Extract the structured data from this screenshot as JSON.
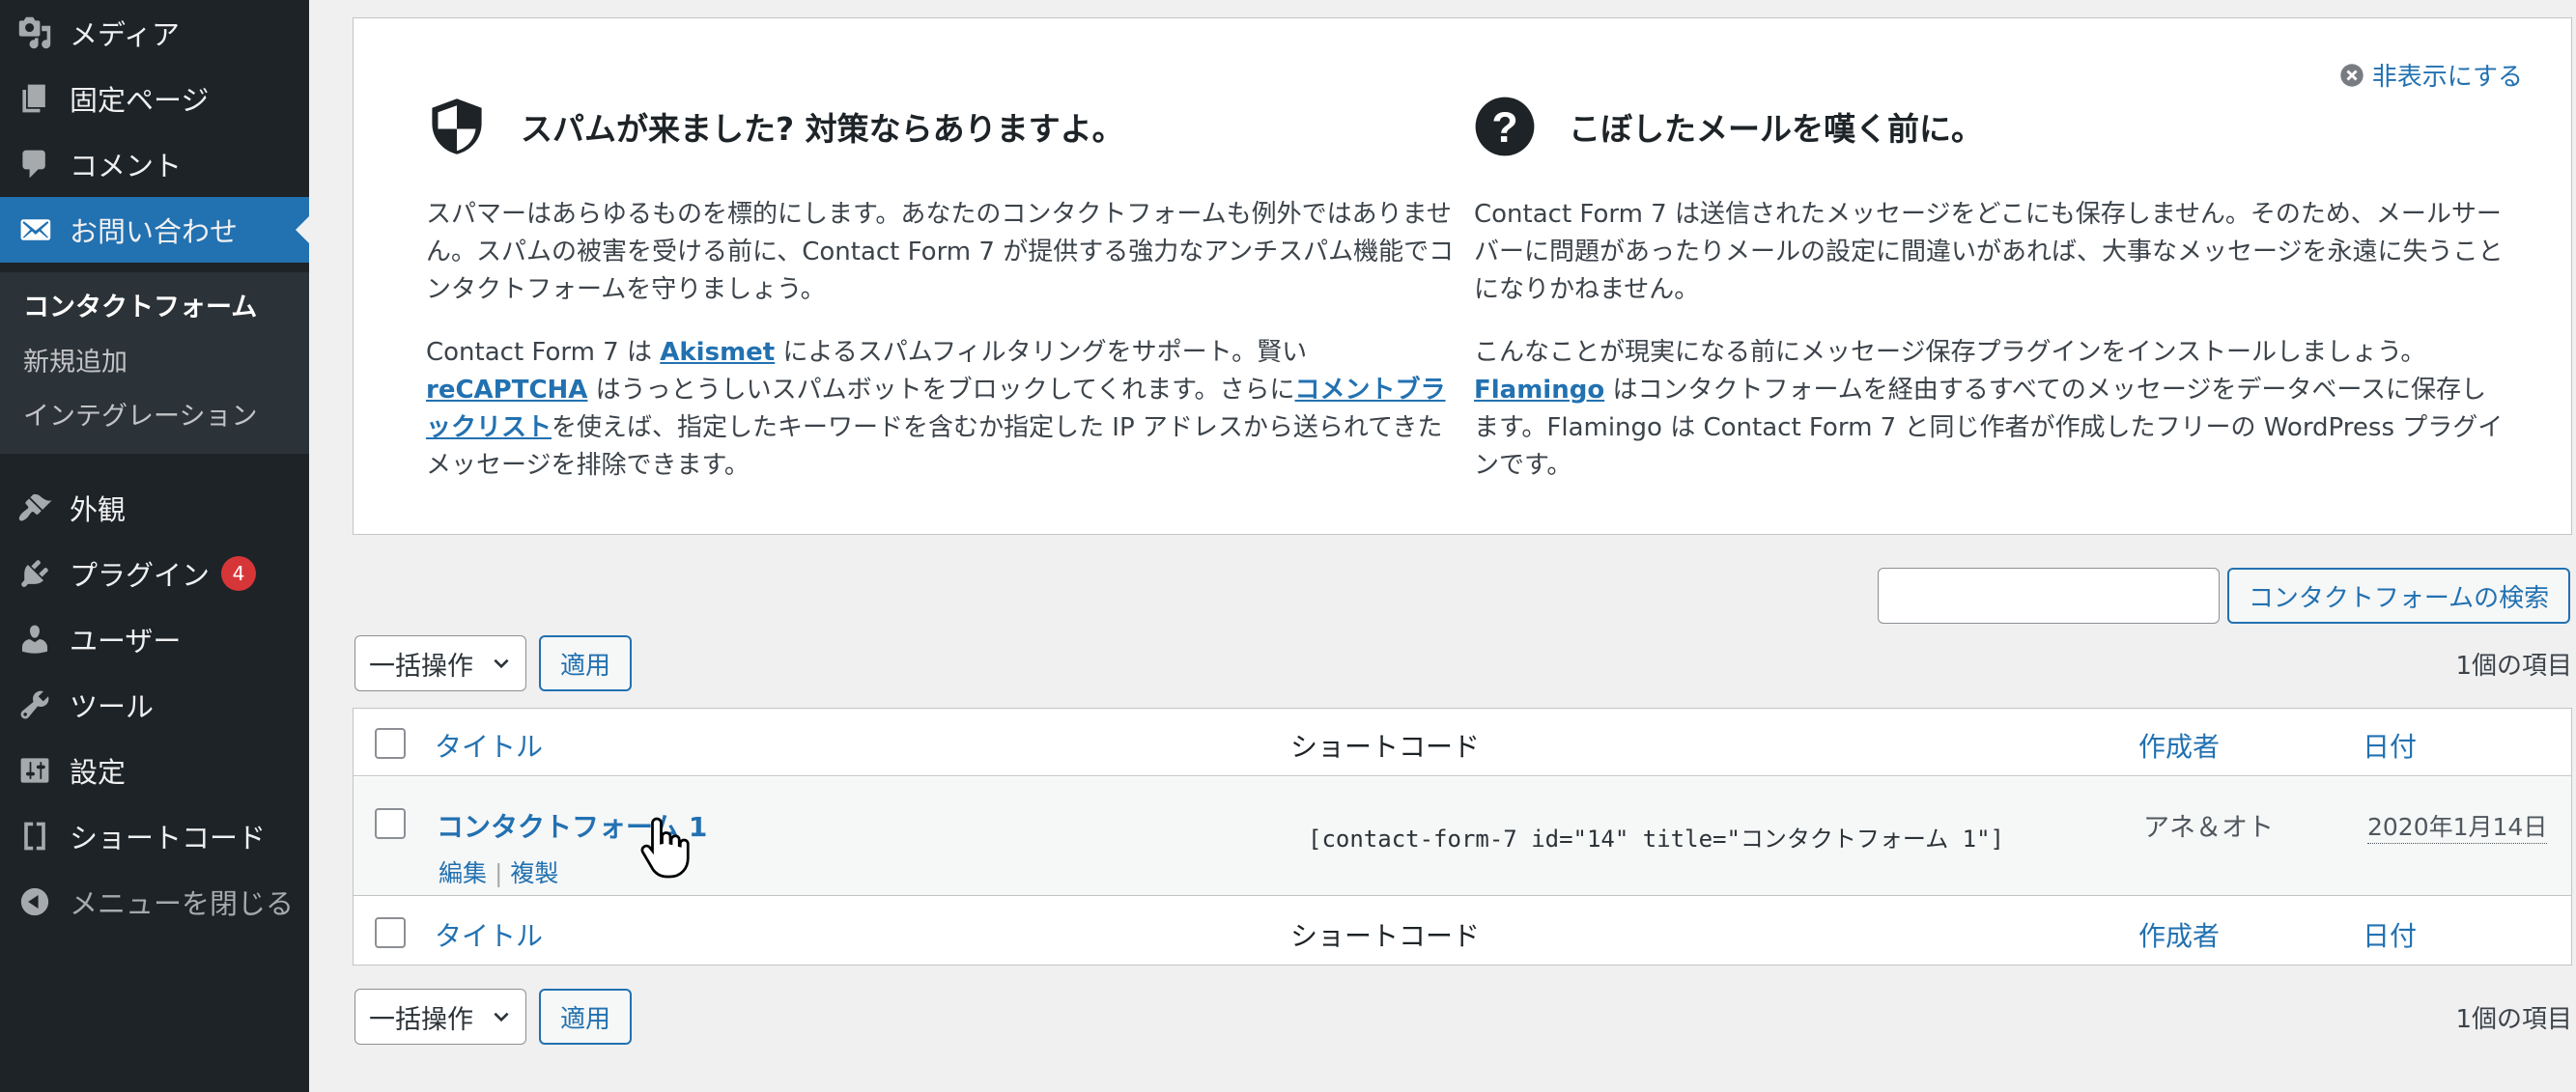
{
  "sidebar": {
    "items": [
      {
        "label": "メディア",
        "icon": "media-icon"
      },
      {
        "label": "固定ページ",
        "icon": "pages-icon"
      },
      {
        "label": "コメント",
        "icon": "comments-icon"
      },
      {
        "label": "お問い合わせ",
        "icon": "mail-icon"
      },
      {
        "label": "外観",
        "icon": "appearance-icon"
      },
      {
        "label": "プラグイン",
        "icon": "plugins-icon",
        "badge": "4"
      },
      {
        "label": "ユーザー",
        "icon": "users-icon"
      },
      {
        "label": "ツール",
        "icon": "tools-icon"
      },
      {
        "label": "設定",
        "icon": "settings-icon"
      },
      {
        "label": "ショートコード",
        "icon": "shortcode-icon"
      },
      {
        "label": "メニューを閉じる",
        "icon": "collapse-icon"
      }
    ],
    "submenu": [
      {
        "label": "コンタクトフォーム"
      },
      {
        "label": "新規追加"
      },
      {
        "label": "インテグレーション"
      }
    ]
  },
  "welcome": {
    "dismiss_label": "非表示にする",
    "left": {
      "title": "スパムが来ました? 対策ならありますよ。",
      "para1": "スパマーはあらゆるものを標的にします。あなたのコンタクトフォームも例外ではありません。スパムの被害を受ける前に、Contact Form 7 が提供する強力なアンチスパム機能でコンタクトフォームを守りましょう。",
      "para2_parts": [
        "Contact Form 7 は ",
        "Akismet",
        " によるスパムフィルタリングをサポート。賢い ",
        "reCAPTCHA",
        " はうっとうしいスパムボットをブロックしてくれます。さらに",
        "コメントブラックリスト",
        "を使えば、指定したキーワードを含むか指定した IP アドレスから送られてきたメッセージを排除できます。"
      ]
    },
    "right": {
      "title": "こぼしたメールを嘆く前に。",
      "para1": "Contact Form 7 は送信されたメッセージをどこにも保存しません。そのため、メールサーバーに問題があったりメールの設定に間違いがあれば、大事なメッセージを永遠に失うことになりかねません。",
      "para2_parts": [
        "こんなことが現実になる前にメッセージ保存プラグインをインストールしましょう。",
        "Flamingo",
        " はコンタクトフォームを経由するすべてのメッセージをデータベースに保存します。Flamingo は Contact Form 7 と同じ作者が作成したフリーの WordPress プラグインです。"
      ]
    }
  },
  "search": {
    "button_label": "コンタクトフォームの検索",
    "value": ""
  },
  "bulk": {
    "label": "一括操作",
    "apply_label": "適用",
    "count": "1個の項目"
  },
  "table": {
    "columns": {
      "title": "タイトル",
      "shortcode": "ショートコード",
      "author": "作成者",
      "date": "日付"
    },
    "rows": [
      {
        "title": "コンタクトフォーム 1",
        "actions": [
          "編集",
          "複製"
        ],
        "shortcode": "[contact-form-7 id=\"14\" title=\"コンタクトフォーム 1\"]",
        "author": "アネ＆オト",
        "date": "2020年1月14日"
      }
    ]
  },
  "colors": {
    "accent": "#2271b1",
    "sidebar_bg": "#1d2327",
    "badge": "#d63638"
  }
}
